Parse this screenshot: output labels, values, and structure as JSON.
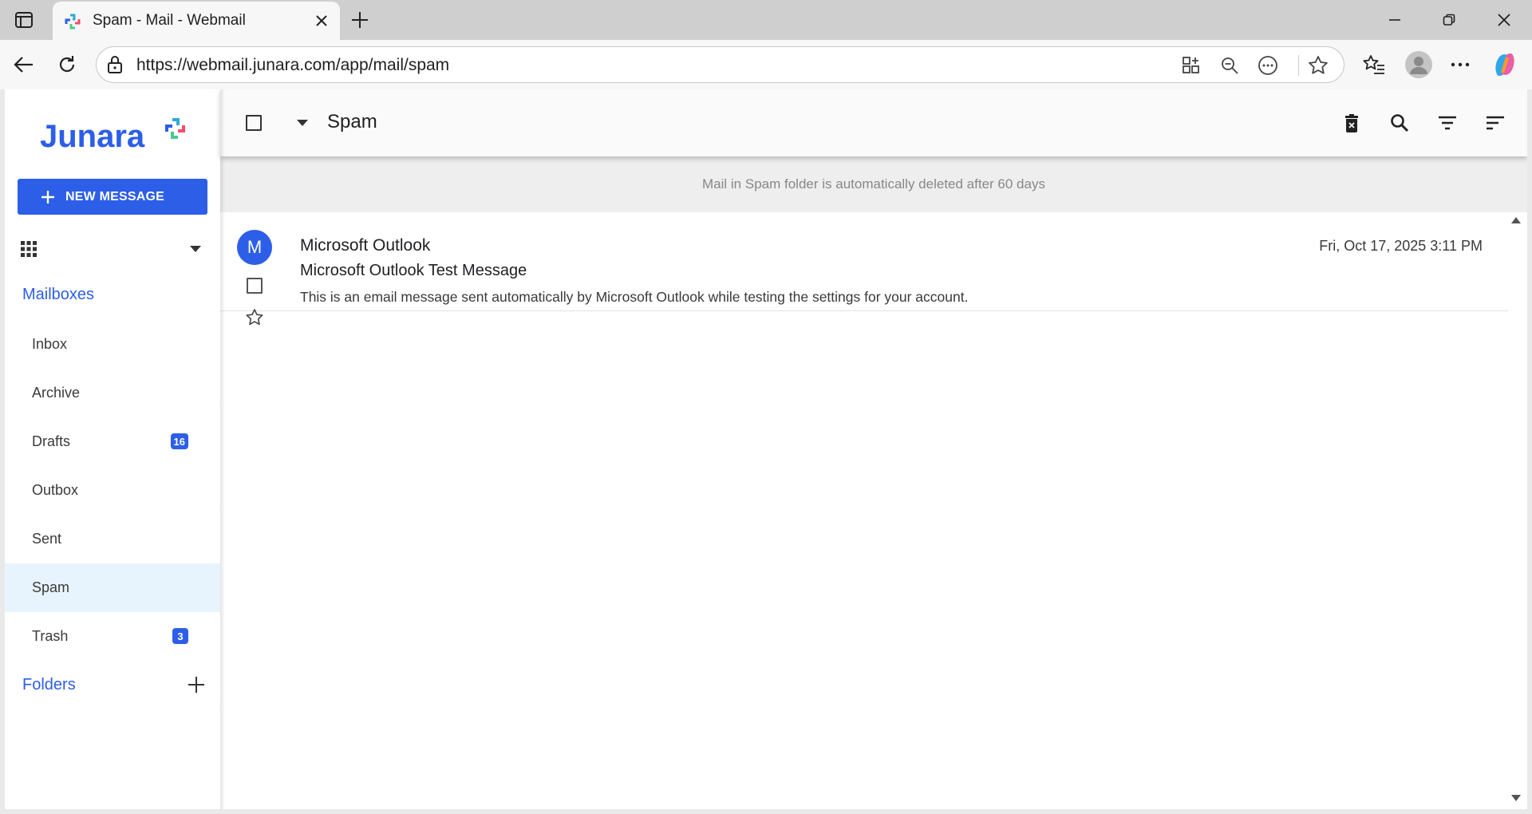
{
  "browser": {
    "tab_title": "Spam - Mail - Webmail",
    "url": "https://webmail.junara.com/app/mail/spam"
  },
  "sidebar": {
    "brand": "Junara",
    "new_message_label": "NEW MESSAGE",
    "mailboxes_title": "Mailboxes",
    "items": [
      {
        "label": "Inbox",
        "badge": ""
      },
      {
        "label": "Archive",
        "badge": ""
      },
      {
        "label": "Drafts",
        "badge": "16"
      },
      {
        "label": "Outbox",
        "badge": ""
      },
      {
        "label": "Sent",
        "badge": ""
      },
      {
        "label": "Spam",
        "badge": ""
      },
      {
        "label": "Trash",
        "badge": "3"
      }
    ],
    "folders_title": "Folders"
  },
  "main": {
    "header_title": "Spam",
    "notice": "Mail in Spam folder is automatically deleted after 60 days",
    "messages": [
      {
        "avatar_letter": "M",
        "from": "Microsoft Outlook",
        "subject": "Microsoft Outlook Test Message",
        "preview": "This is an email message sent automatically by Microsoft Outlook while testing the settings for your account.",
        "date": "Fri, Oct 17, 2025 3:11 PM"
      }
    ]
  },
  "colors": {
    "accent": "#2c5ee8",
    "active_item_bg": "#e8f4fd",
    "notice_bg": "#eeeeee"
  },
  "icons": [
    "sidebar-toggle-icon",
    "favicon-icon",
    "close-icon",
    "plus-icon",
    "minimize-icon",
    "restore-icon",
    "back-icon",
    "refresh-icon",
    "lock-icon",
    "apps-icon",
    "zoom-out-icon",
    "more-icon",
    "star-icon",
    "favorites-icon",
    "profile-icon",
    "copilot-icon",
    "delete-icon",
    "search-icon",
    "filter-icon",
    "sort-icon",
    "grid-icon",
    "chevron-down-icon"
  ]
}
